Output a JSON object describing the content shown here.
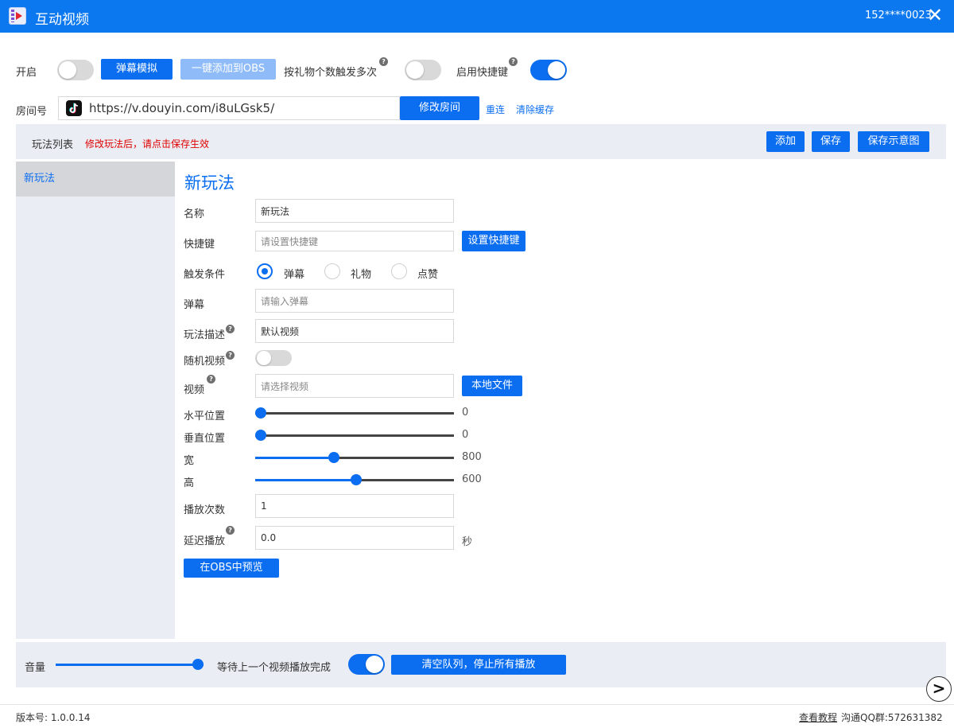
{
  "window": {
    "title": "互动视频",
    "account": "152****0023",
    "close_symbol": "✕"
  },
  "top": {
    "enable_label": "开启",
    "enable_on": false,
    "simulate_btn": "弹幕模拟",
    "add_obs_btn": "一键添加到OBS",
    "gift_trigger_label": "按礼物个数触发多次",
    "gift_trigger_on": false,
    "hotkey_label": "启用快捷键",
    "hotkey_on": true,
    "help_symbol": "?"
  },
  "room": {
    "label": "房间号",
    "url": "https://v.douyin.com/i8uLGsk5/",
    "modify_btn": "修改房间",
    "reconnect_link": "重连",
    "clear_cache_link": "清除缓存",
    "icon": "tiktok-icon"
  },
  "play_list": {
    "title": "玩法列表",
    "warning": "修改玩法后，请点击保存生效",
    "add_btn": "添加",
    "save_btn": "保存",
    "save_diagram_btn": "保存示意图",
    "items": [
      "新玩法"
    ]
  },
  "form": {
    "heading": "新玩法",
    "name_label": "名称",
    "name_value": "新玩法",
    "hotkey_label": "快捷键",
    "hotkey_placeholder": "请设置快捷键",
    "set_hotkey_btn": "设置快捷键",
    "trigger_label": "触发条件",
    "trigger_options": [
      "弹幕",
      "礼物",
      "点赞"
    ],
    "trigger_selected": "弹幕",
    "danmu_label": "弹幕",
    "danmu_placeholder": "请输入弹幕",
    "desc_label": "玩法描述",
    "desc_value": "默认视频",
    "random_label": "随机视频",
    "random_on": false,
    "video_label": "视频",
    "video_placeholder": "请选择视频",
    "local_file_btn": "本地文件",
    "h_pos_label": "水平位置",
    "h_pos_value": "0",
    "h_pos_fraction": 0.0,
    "v_pos_label": "垂直位置",
    "v_pos_value": "0",
    "v_pos_fraction": 0.0,
    "width_label": "宽",
    "width_value": "800",
    "width_fraction": 0.395,
    "height_label": "高",
    "height_value": "600",
    "height_fraction": 0.507,
    "play_count_label": "播放次数",
    "play_count_value": "1",
    "delay_label": "延迟播放",
    "delay_value": "0.0",
    "delay_unit": "秒",
    "preview_btn": "在OBS中预览"
  },
  "bottom": {
    "volume_label": "音量",
    "volume_fraction": 1.0,
    "wait_label": "等待上一个视频播放完成",
    "wait_on": true,
    "clear_btn": "清空队列，停止所有播放",
    "next_symbol": ">"
  },
  "footer": {
    "version": "版本号: 1.0.0.14",
    "tutorial_link": "查看教程",
    "qq_group": "沟通QQ群:572631382"
  },
  "colors": {
    "accent": "#0b6ef0",
    "titlebar": "#0b78f0",
    "warning": "#e00000",
    "panel_bg": "#eaedf3"
  }
}
